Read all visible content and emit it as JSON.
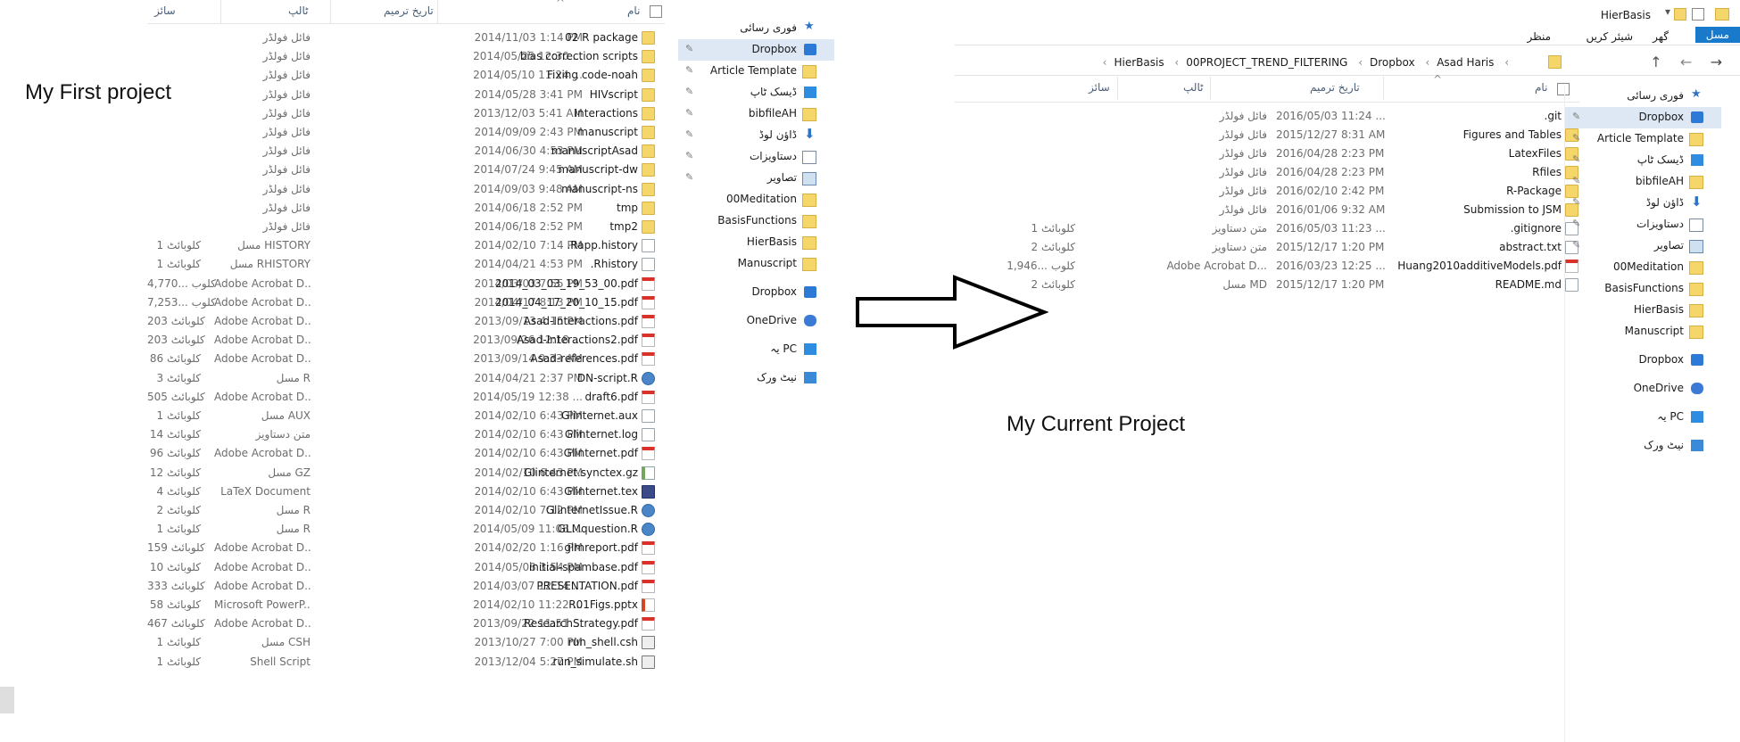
{
  "left": {
    "columns": {
      "name": "نام",
      "date": "تاریخ ترمیم",
      "type": "ٹالپ",
      "size": "سائز"
    },
    "rows": [
      {
        "name": "02 R package",
        "date": "2014/11/03 1:14 PM",
        "type": "فائل فولڈر",
        "size": "",
        "icon": "folder"
      },
      {
        "name": "bias correction scripts",
        "date": "2014/05/25 12:30 ...",
        "type": "فائل فولڈر",
        "size": "",
        "icon": "folder"
      },
      {
        "name": "Fixing code-noah",
        "date": "2014/05/10 11:24 ...",
        "type": "فائل فولڈر",
        "size": "",
        "icon": "folder"
      },
      {
        "name": "HIVscript",
        "date": "2014/05/28 3:41 PM",
        "type": "فائل فولڈر",
        "size": "",
        "icon": "folder"
      },
      {
        "name": "Interactions",
        "date": "2013/12/03 5:41 AM",
        "type": "فائل فولڈر",
        "size": "",
        "icon": "folder"
      },
      {
        "name": "manuscript",
        "date": "2014/09/09 2:43 PM",
        "type": "فائل فولڈر",
        "size": "",
        "icon": "folder"
      },
      {
        "name": "manuscriptAsad",
        "date": "2014/06/30 4:53 PM",
        "type": "فائل فولڈر",
        "size": "",
        "icon": "folder"
      },
      {
        "name": "manuscript-dw",
        "date": "2014/07/24 9:45 AM",
        "type": "فائل فولڈر",
        "size": "",
        "icon": "folder"
      },
      {
        "name": "manuscript-ns",
        "date": "2014/09/03 9:48 AM",
        "type": "فائل فولڈر",
        "size": "",
        "icon": "folder"
      },
      {
        "name": "tmp",
        "date": "2014/06/18 2:52 PM",
        "type": "فائل فولڈر",
        "size": "",
        "icon": "folder"
      },
      {
        "name": "tmp2",
        "date": "2014/06/18 2:52 PM",
        "type": "فائل فولڈر",
        "size": "",
        "icon": "folder"
      },
      {
        "name": ".Rapp.history",
        "date": "2014/02/10 7:14 PM",
        "type": "مسل HISTORY",
        "size": "1 کلوبائٹ",
        "icon": "doc"
      },
      {
        "name": ".Rhistory",
        "date": "2014/04/21 4:53 PM",
        "type": "مسل RHISTORY",
        "size": "1 کلوبائٹ",
        "icon": "doc"
      },
      {
        "name": "2014_03_03_19_53_00.pdf",
        "date": "2014/03/03 7:55 PM",
        "type": "Adobe Acrobat D...",
        "size": "4,770... کلوب",
        "icon": "pdf"
      },
      {
        "name": "2014_04_17_20_10_15.pdf",
        "date": "2014/04/17 8:13 PM",
        "type": "Adobe Acrobat D...",
        "size": "7,253... کلوب",
        "icon": "pdf"
      },
      {
        "name": "Asad-Interactions.pdf",
        "date": "2013/09/13 4:15 PM",
        "type": "Adobe Acrobat D...",
        "size": "203 کلوبائٹ",
        "icon": "pdf"
      },
      {
        "name": "Asad-Interactions2.pdf",
        "date": "2013/09/26 12:18 ...",
        "type": "Adobe Acrobat D...",
        "size": "203 کلوبائٹ",
        "icon": "pdf"
      },
      {
        "name": "Asad-references.pdf",
        "date": "2013/09/14 9:33 AM",
        "type": "Adobe Acrobat D...",
        "size": "86 کلوبائٹ",
        "icon": "pdf"
      },
      {
        "name": "DN-script.R",
        "date": "2014/04/21 2:37 PM",
        "type": "مسل R",
        "size": "3 کلوبائٹ",
        "icon": "r"
      },
      {
        "name": "draft6.pdf",
        "date": "2014/05/19 12:38 ...",
        "type": "Adobe Acrobat D...",
        "size": "505 کلوبائٹ",
        "icon": "pdf"
      },
      {
        "name": "Glinternet.aux",
        "date": "2014/02/10 6:43 PM",
        "type": "مسل AUX",
        "size": "1 کلوبائٹ",
        "icon": "doc"
      },
      {
        "name": "Glinternet.log",
        "date": "2014/02/10 6:43 PM",
        "type": "متن دستاویز",
        "size": "14 کلوبائٹ",
        "icon": "doc"
      },
      {
        "name": "Glinternet.pdf",
        "date": "2014/02/10 6:43 PM",
        "type": "Adobe Acrobat D...",
        "size": "96 کلوبائٹ",
        "icon": "pdf"
      },
      {
        "name": "Glinternet.synctex.gz",
        "date": "2014/02/10 6:43 PM",
        "type": "مسل GZ",
        "size": "12 کلوبائٹ",
        "icon": "zip"
      },
      {
        "name": "Glinternet.tex",
        "date": "2014/02/10 6:43 PM",
        "type": "LaTeX Document",
        "size": "4 کلوبائٹ",
        "icon": "tex"
      },
      {
        "name": "GlinternetIssue.R",
        "date": "2014/02/10 7:12 PM",
        "type": "مسل R",
        "size": "2 کلوبائٹ",
        "icon": "r"
      },
      {
        "name": "GLMquestion.R",
        "date": "2014/05/09 11:08 ...",
        "type": "مسل R",
        "size": "1 کلوبائٹ",
        "icon": "r"
      },
      {
        "name": "glmreport.pdf",
        "date": "2014/02/20 1:16 PM",
        "type": "Adobe Acrobat D...",
        "size": "159 کلوبائٹ",
        "icon": "pdf"
      },
      {
        "name": "initial-spambase.pdf",
        "date": "2014/05/08 3:54 PM",
        "type": "Adobe Acrobat D...",
        "size": "10 کلوبائٹ",
        "icon": "pdf"
      },
      {
        "name": "PRESENTATION.pdf",
        "date": "2014/03/07 12:14 ...",
        "type": "Adobe Acrobat D...",
        "size": "333 کلوبائٹ",
        "icon": "pdf"
      },
      {
        "name": "R01Figs.pptx",
        "date": "2014/02/10 11:22 ...",
        "type": "Microsoft PowerP...",
        "size": "58 کلوبائٹ",
        "icon": "ppt"
      },
      {
        "name": "ResearchStrategy.pdf",
        "date": "2013/09/22 11:51 ...",
        "type": "Adobe Acrobat D...",
        "size": "467 کلوبائٹ",
        "icon": "pdf"
      },
      {
        "name": "run_shell.csh",
        "date": "2013/10/27 7:00 PM",
        "type": "مسل CSH",
        "size": "1 کلوبائٹ",
        "icon": "sh"
      },
      {
        "name": "run_simulate.sh",
        "date": "2013/12/04 5:27 PM",
        "type": "Shell Script",
        "size": "1 کلوبائٹ",
        "icon": "sh"
      }
    ],
    "nav": [
      {
        "label": "فوری رسائی",
        "icon": "star",
        "pin": false
      },
      {
        "label": "Dropbox",
        "icon": "dropbox",
        "pin": true,
        "selected": true
      },
      {
        "label": "Article Template",
        "icon": "folder",
        "pin": true
      },
      {
        "label": "ڈیسک ٹاپ",
        "icon": "desk",
        "pin": true
      },
      {
        "label": "bibfileAH",
        "icon": "folder",
        "pin": true
      },
      {
        "label": "ڈاؤن لوڈ",
        "icon": "down",
        "pin": true
      },
      {
        "label": "دستاویزات",
        "icon": "docs",
        "pin": true
      },
      {
        "label": "تصاویر",
        "icon": "pics",
        "pin": true
      },
      {
        "label": "00Meditation",
        "icon": "folder",
        "pin": false
      },
      {
        "label": "BasisFunctions",
        "icon": "folder",
        "pin": false
      },
      {
        "label": "HierBasis",
        "icon": "folder",
        "pin": false
      },
      {
        "label": "Manuscript",
        "icon": "folder",
        "pin": false
      },
      {
        "label": "Dropbox",
        "icon": "dropbox",
        "pin": false
      },
      {
        "label": "OneDrive",
        "icon": "cloud",
        "pin": false
      },
      {
        "label": "یہ PC",
        "icon": "pc",
        "pin": false
      },
      {
        "label": "نیٹ ورک",
        "icon": "net",
        "pin": false
      }
    ]
  },
  "right": {
    "title": "HierBasis",
    "ribbon_tabs": [
      "مسل",
      "گھر",
      "شیئر کریں",
      "منظر"
    ],
    "breadcrumb": [
      "Asad Haris",
      "Dropbox",
      "00PROJECT_TREND_FILTERING",
      "HierBasis"
    ],
    "columns": {
      "name": "نام",
      "date": "تاریخ ترمیم",
      "type": "ٹالپ",
      "size": "سائز"
    },
    "rows": [
      {
        "name": ".git",
        "date": "2016/05/03 11:24 ...",
        "type": "فائل فولڈر",
        "size": "",
        "icon": "folder"
      },
      {
        "name": "Figures and Tables",
        "date": "2015/12/27 8:31 AM",
        "type": "فائل فولڈر",
        "size": "",
        "icon": "folder"
      },
      {
        "name": "LatexFiles",
        "date": "2016/04/28 2:23 PM",
        "type": "فائل فولڈر",
        "size": "",
        "icon": "folder"
      },
      {
        "name": "Rfiles",
        "date": "2016/04/28 2:23 PM",
        "type": "فائل فولڈر",
        "size": "",
        "icon": "folder"
      },
      {
        "name": "R-Package",
        "date": "2016/02/10 2:42 PM",
        "type": "فائل فولڈر",
        "size": "",
        "icon": "folder"
      },
      {
        "name": "Submission to JSM",
        "date": "2016/01/06 9:32 AM",
        "type": "فائل فولڈر",
        "size": "",
        "icon": "folder"
      },
      {
        "name": ".gitignore",
        "date": "2016/05/03 11:23 ...",
        "type": "متن دستاویز",
        "size": "1 کلوبائٹ",
        "icon": "doc"
      },
      {
        "name": "abstract.txt",
        "date": "2015/12/17 1:20 PM",
        "type": "متن دستاویز",
        "size": "2 کلوبائٹ",
        "icon": "doc"
      },
      {
        "name": "Huang2010additiveModels.pdf",
        "date": "2016/03/23 12:25 ...",
        "type": "Adobe Acrobat D...",
        "size": "1,946... کلوب",
        "icon": "pdf"
      },
      {
        "name": "README.md",
        "date": "2015/12/17 1:20 PM",
        "type": "مسل MD",
        "size": "2 کلوبائٹ",
        "icon": "doc"
      }
    ],
    "nav": [
      {
        "label": "فوری رسائی",
        "icon": "star",
        "pin": false
      },
      {
        "label": "Dropbox",
        "icon": "dropbox",
        "pin": true,
        "selected": true
      },
      {
        "label": "Article Template",
        "icon": "folder",
        "pin": true
      },
      {
        "label": "ڈیسک ٹاپ",
        "icon": "desk",
        "pin": true
      },
      {
        "label": "bibfileAH",
        "icon": "folder",
        "pin": true
      },
      {
        "label": "ڈاؤن لوڈ",
        "icon": "down",
        "pin": true
      },
      {
        "label": "دستاویزات",
        "icon": "docs",
        "pin": true
      },
      {
        "label": "تصاویر",
        "icon": "pics",
        "pin": true
      },
      {
        "label": "00Meditation",
        "icon": "folder",
        "pin": false
      },
      {
        "label": "BasisFunctions",
        "icon": "folder",
        "pin": false
      },
      {
        "label": "HierBasis",
        "icon": "folder",
        "pin": false
      },
      {
        "label": "Manuscript",
        "icon": "folder",
        "pin": false
      },
      {
        "label": "Dropbox",
        "icon": "dropbox",
        "pin": false
      },
      {
        "label": "OneDrive",
        "icon": "cloud",
        "pin": false
      },
      {
        "label": "یہ PC",
        "icon": "pc",
        "pin": false
      },
      {
        "label": "نیٹ ورک",
        "icon": "net",
        "pin": false
      }
    ]
  },
  "annotations": {
    "first": "My First project",
    "current": "My Current Project"
  },
  "colors": {
    "selection": "#dde8f4",
    "accent": "#1979ca",
    "folder": "#f5d66b"
  }
}
